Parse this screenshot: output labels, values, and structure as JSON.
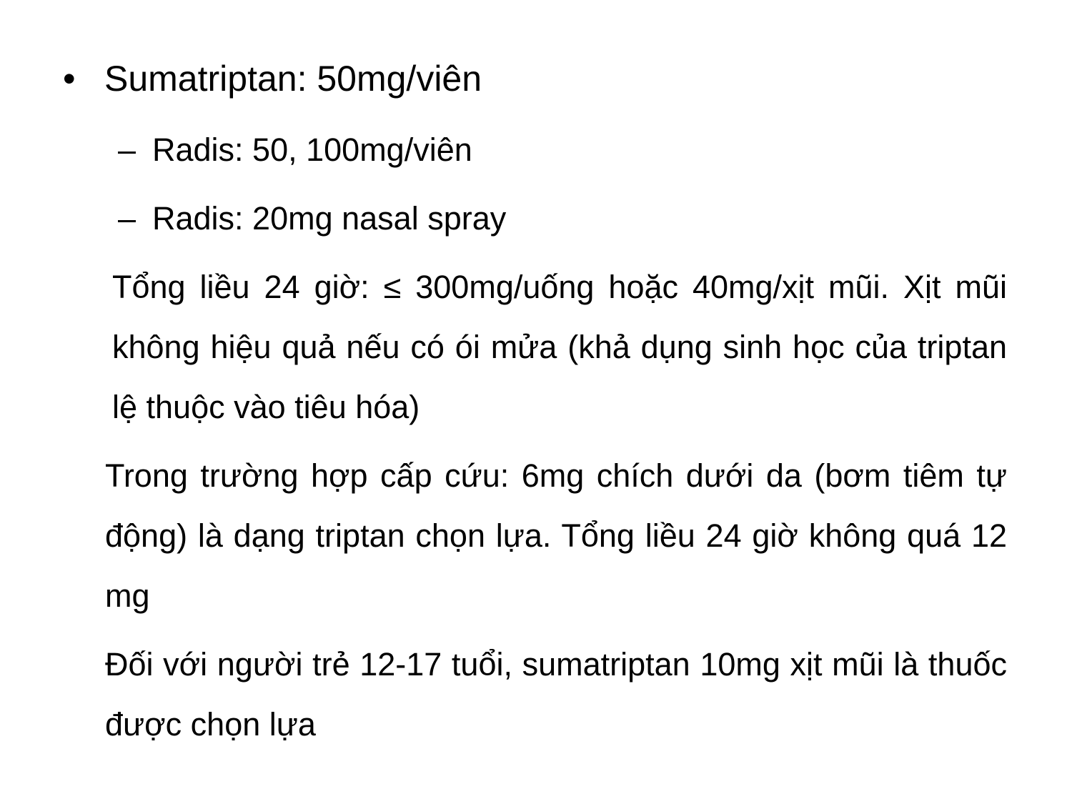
{
  "slide": {
    "bullet": {
      "marker": "•",
      "text": "Sumatriptan: 50mg/viên"
    },
    "sub_items": [
      {
        "marker": "–",
        "text": "Radis: 50, 100mg/viên"
      },
      {
        "marker": "–",
        "text": "Radis: 20mg nasal spray"
      }
    ],
    "paragraphs": [
      "Tổng liều 24 giờ: ≤ 300mg/uống hoặc 40mg/xịt mũi. Xịt mũi không hiệu quả nếu có ói mửa (khả dụng sinh học của triptan lệ thuộc vào tiêu hóa)",
      "Trong trường hợp cấp cứu: 6mg chích dưới da (bơm tiêm tự động) là dạng triptan chọn lựa. Tổng liều 24 giờ không quá 12 mg",
      "Đối với người trẻ 12-17 tuổi, sumatriptan 10mg xịt mũi là thuốc được chọn lựa"
    ]
  }
}
